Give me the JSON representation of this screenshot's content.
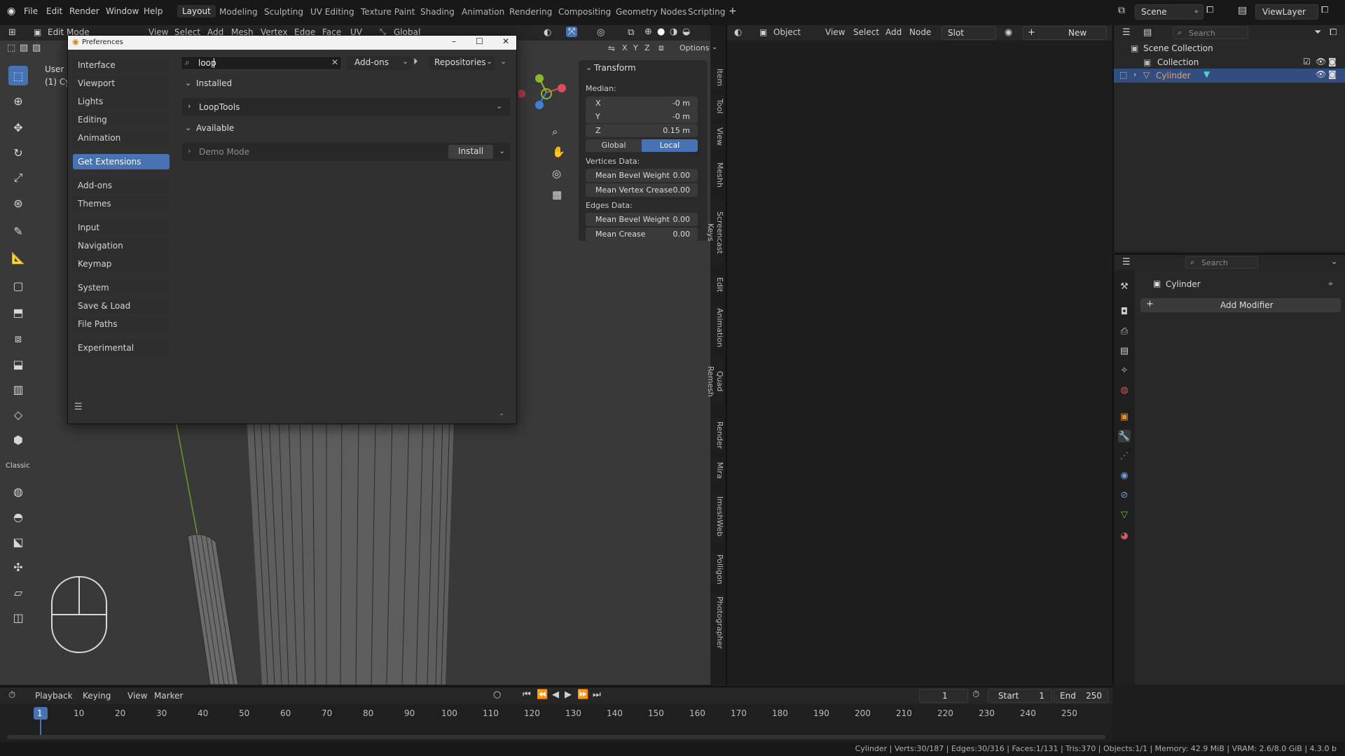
{
  "menu": {
    "file": "File",
    "edit": "Edit",
    "render": "Render",
    "window": "Window",
    "help": "Help"
  },
  "workspaces": [
    "Layout",
    "Modeling",
    "Sculpting",
    "UV Editing",
    "Texture Paint",
    "Shading",
    "Animation",
    "Rendering",
    "Compositing",
    "Geometry Nodes",
    "Scripting"
  ],
  "scene": {
    "label": "Scene",
    "viewlayer": "ViewLayer"
  },
  "viewport_header": {
    "mode": "Edit Mode",
    "view": "View",
    "select": "Select",
    "add": "Add",
    "mesh": "Mesh",
    "vertex": "Vertex",
    "edge": "Edge",
    "face": "Face",
    "uv": "UV",
    "orientation": "Global",
    "options": "Options",
    "x": "X",
    "y": "Y",
    "z": "Z"
  },
  "viewport_overlay": {
    "line1": "User F",
    "line2": "(1) Cy"
  },
  "n_panel": {
    "title": "Transform",
    "median": "Median:",
    "x_label": "X",
    "x_value": "-0 m",
    "y_label": "Y",
    "y_value": "-0 m",
    "z_label": "Z",
    "z_value": "0.15 m",
    "global": "Global",
    "local": "Local",
    "vertices_data": "Vertices Data:",
    "mean_bevel_weight_v": "Mean Bevel Weight",
    "mean_bevel_weight_v_val": "0.00",
    "mean_vertex_crease": "Mean Vertex Crease",
    "mean_vertex_crease_val": "0.00",
    "edges_data": "Edges Data:",
    "mean_bevel_weight_e": "Mean Bevel Weight",
    "mean_bevel_weight_e_val": "0.00",
    "mean_crease": "Mean Crease",
    "mean_crease_val": "0.00"
  },
  "n_tabs": [
    "Item",
    "Tool",
    "View",
    "Meshh",
    "Screencast Keys",
    "Edit",
    "Animation",
    "Quad Remesh",
    "Render",
    "Mira",
    "ImeshWeb",
    "Polligon",
    "Photographer"
  ],
  "node_header": {
    "object": "Object",
    "view": "View",
    "select": "Select",
    "add": "Add",
    "node": "Node",
    "slot": "Slot",
    "new": "New"
  },
  "outliner": {
    "search_placeholder": "Search",
    "scene_collection": "Scene Collection",
    "collection": "Collection",
    "object": "Cylinder"
  },
  "properties": {
    "search_placeholder": "Search",
    "object": "Cylinder",
    "add_modifier": "Add Modifier"
  },
  "preferences": {
    "title": "Preferences",
    "search_value": "loop",
    "filter": "Add-ons",
    "repositories": "Repositories",
    "installed_header": "Installed",
    "installed_item": "LoopTools",
    "available_header": "Available",
    "available_item": "Demo Mode",
    "install_button": "Install",
    "sidebar": [
      "Interface",
      "Viewport",
      "Lights",
      "Editing",
      "Animation",
      "Get Extensions",
      "Add-ons",
      "Themes",
      "Input",
      "Navigation",
      "Keymap",
      "System",
      "Save & Load",
      "File Paths",
      "Experimental"
    ],
    "active_item": "Get Extensions"
  },
  "timeline": {
    "playback": "Playback",
    "keying": "Keying",
    "view": "View",
    "marker": "Marker",
    "current_frame": "1",
    "start_label": "Start",
    "start": "1",
    "end_label": "End",
    "end": "250",
    "ticks": [
      "1",
      "10",
      "20",
      "30",
      "40",
      "50",
      "60",
      "70",
      "80",
      "90",
      "100",
      "110",
      "120",
      "130",
      "140",
      "150",
      "160",
      "170",
      "180",
      "190",
      "200",
      "210",
      "220",
      "230",
      "240",
      "250"
    ]
  },
  "status_bar": {
    "text": "Cylinder | Verts:30/187 | Edges:30/316 | Faces:1/131 | Tris:370 | Objects:1/1 | Memory: 42.9 MiB | VRAM: 2.6/8.0 GiB | 4.3.0 b"
  },
  "tool_label": "Classic",
  "colors": {
    "accent": "#4772b3",
    "axis_x": "#e04a5a",
    "axis_y": "#8bb62f",
    "axis_z": "#3d82d6",
    "background": "#1d1d1d"
  }
}
